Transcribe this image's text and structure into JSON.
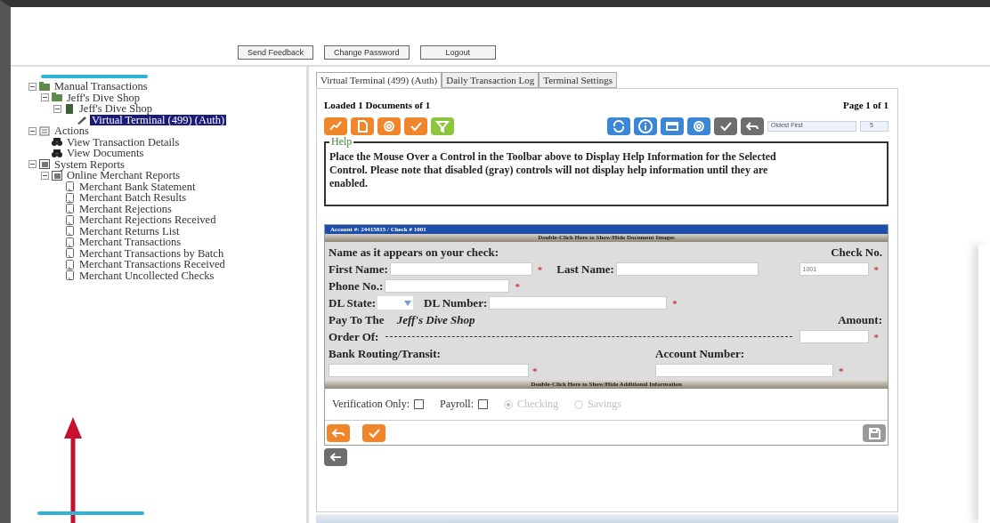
{
  "header": {
    "buttons": [
      "Send Feedback",
      "Change Password",
      "Logout"
    ]
  },
  "tree": [
    {
      "label": "Manual Transactions",
      "kind": "folder",
      "expanded": true,
      "selected": false,
      "children": [
        {
          "label": "Jeff's Dive Shop",
          "kind": "folder",
          "expanded": true,
          "selected": false,
          "children": [
            {
              "label": "Jeff's Dive Shop",
              "kind": "book",
              "expanded": true,
              "selected": false,
              "children": [
                {
                  "label": "Virtual Terminal (499) (Auth)",
                  "kind": "pen",
                  "selected": true
                }
              ]
            }
          ]
        }
      ]
    },
    {
      "label": "Actions",
      "kind": "actions",
      "expanded": true,
      "selected": false,
      "children": [
        {
          "label": "View Transaction Details",
          "kind": "binoculars",
          "selected": false
        },
        {
          "label": "View Documents",
          "kind": "binoculars",
          "selected": false
        }
      ]
    },
    {
      "label": "System Reports",
      "kind": "report",
      "expanded": true,
      "selected": false,
      "children": [
        {
          "label": "Online Merchant Reports",
          "kind": "report",
          "expanded": true,
          "selected": false,
          "children": [
            {
              "label": "Merchant Bank Statement",
              "kind": "page",
              "selected": false
            },
            {
              "label": "Merchant Batch Results",
              "kind": "page",
              "selected": false
            },
            {
              "label": "Merchant Rejections",
              "kind": "page",
              "selected": false
            },
            {
              "label": "Merchant Rejections Received",
              "kind": "page",
              "selected": false
            },
            {
              "label": "Merchant Returns List",
              "kind": "page",
              "selected": false
            },
            {
              "label": "Merchant Transactions",
              "kind": "page",
              "selected": false
            },
            {
              "label": "Merchant Transactions by Batch",
              "kind": "page",
              "selected": false
            },
            {
              "label": "Merchant Transactions Received",
              "kind": "page",
              "selected": false
            },
            {
              "label": "Merchant Uncollected Checks",
              "kind": "page",
              "selected": false
            }
          ]
        }
      ]
    }
  ],
  "tabs": [
    {
      "label": "Virtual Terminal (499) (Auth)",
      "selected": true
    },
    {
      "label": "Daily Transaction Log",
      "selected": false
    },
    {
      "label": "Terminal Settings",
      "selected": false
    }
  ],
  "loaded": "Loaded 1 Documents of 1",
  "page": "Page 1 of 1",
  "toolbar_left": [
    {
      "kind": "chart",
      "color": "#f0852a"
    },
    {
      "kind": "document",
      "color": "#f0852a"
    },
    {
      "kind": "gear",
      "color": "#f0852a"
    },
    {
      "kind": "check",
      "color": "#f0852a"
    },
    {
      "kind": "filter",
      "color": "#8cc63f"
    }
  ],
  "toolbar_right": [
    {
      "kind": "refresh",
      "color": "#3b87d6"
    },
    {
      "kind": "info",
      "color": "#3b87d6"
    },
    {
      "kind": "window",
      "color": "#3b87d6"
    },
    {
      "kind": "gear",
      "color": "#3b87d6"
    },
    {
      "kind": "check",
      "color": "#6e6e6e"
    },
    {
      "kind": "undo",
      "color": "#6e6e6e"
    }
  ],
  "sort": {
    "value": "Oldest First"
  },
  "per_page": {
    "value": "5"
  },
  "help": {
    "legend": "Help",
    "text": "Place the Mouse Over a Control in the Toolbar above to Display Help Information for the Selected Control. Please note that disabled (gray) controls will not display help information until they are enabled."
  },
  "check": {
    "header": "Account #: 24415815 / Check # 1001",
    "images_bar": "Double-Click Here to Show/Hide Document Images",
    "name_caption": "Name as it appears on your check:",
    "check_no_label": "Check No.",
    "first_name": "First Name:",
    "last_name": "Last Name:",
    "check_no_placeholder": "1001",
    "phone": "Phone No.:",
    "dl_state": "DL State:",
    "dl_number": "DL Number:",
    "pay_to": "Pay To The",
    "payee": "Jeff's Dive Shop",
    "order_of": "Order Of:",
    "amount": "Amount:",
    "routing": "Bank Routing/Transit:",
    "account": "Account Number:",
    "required": "*",
    "info_bar": "Double-Click Here to Show/Hide Additional Information"
  },
  "options": [
    {
      "kind": "checkbox",
      "label": "Verification Only:",
      "checked": false
    },
    {
      "kind": "checkbox",
      "label": "Payroll:",
      "checked": false
    },
    {
      "kind": "radio",
      "label": "Checking",
      "checked": true,
      "disabled": true
    },
    {
      "kind": "radio",
      "label": "Savings",
      "checked": false,
      "disabled": true
    }
  ],
  "bottom_buttons": [
    {
      "kind": "undo",
      "color": "#f0852a"
    },
    {
      "kind": "check",
      "color": "#f0852a"
    }
  ],
  "save_button": {
    "kind": "save",
    "color": "#9a9a9a"
  },
  "back_button": {
    "kind": "back",
    "color": "#6e6e6e"
  }
}
